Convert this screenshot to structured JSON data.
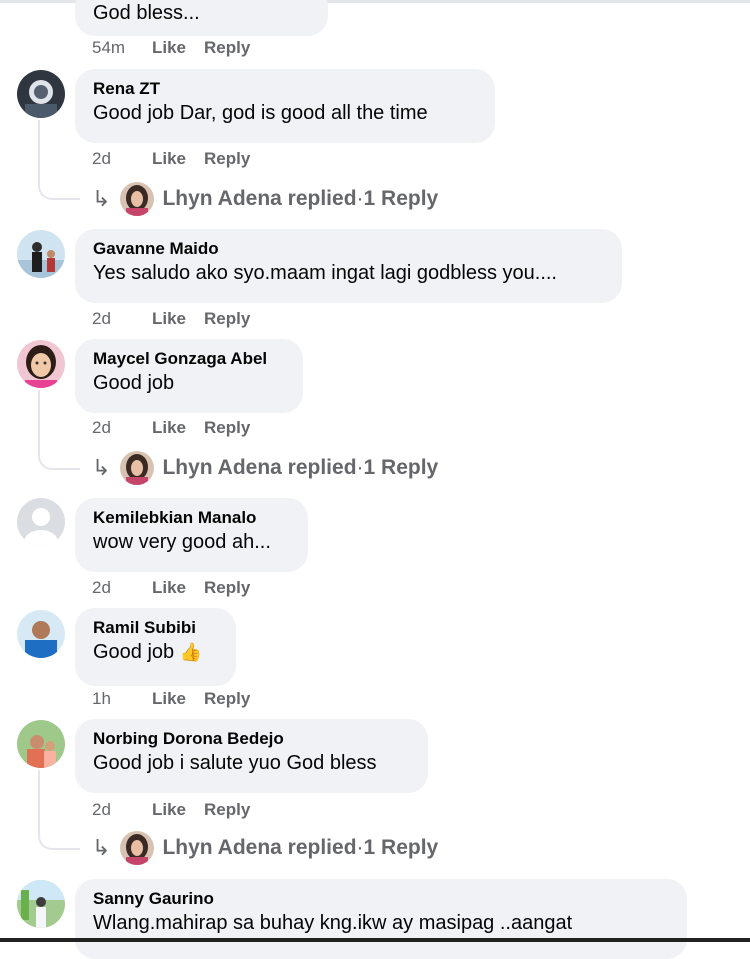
{
  "comments": [
    {
      "name": "",
      "text": "God bless...",
      "time": "54m",
      "like": "Like",
      "reply": "Reply"
    },
    {
      "name": "Rena ZT",
      "text": "Good job Dar, god is good all the time",
      "time": "2d",
      "like": "Like",
      "reply": "Reply",
      "replies_summary": {
        "replier": "Lhyn Adena replied",
        "count": "1 Reply",
        "sep": " · "
      }
    },
    {
      "name": "Gavanne Maido",
      "text": "Yes saludo ako syo.maam ingat lagi godbless you....",
      "time": "2d",
      "like": "Like",
      "reply": "Reply"
    },
    {
      "name": "Maycel Gonzaga Abel",
      "text": "Good job",
      "time": "2d",
      "like": "Like",
      "reply": "Reply",
      "replies_summary": {
        "replier": "Lhyn Adena replied",
        "count": "1 Reply",
        "sep": " · "
      }
    },
    {
      "name": "Kemilebkian Manalo",
      "text": "wow very good ah...",
      "time": "2d",
      "like": "Like",
      "reply": "Reply"
    },
    {
      "name": "Ramil Subibi",
      "text": "Good job",
      "emoji": "👍",
      "time": "1h",
      "like": "Like",
      "reply": "Reply"
    },
    {
      "name": "Norbing Dorona Bedejo",
      "text": "Good job i salute yuo God bless",
      "time": "2d",
      "like": "Like",
      "reply": "Reply",
      "replies_summary": {
        "replier": "Lhyn Adena replied",
        "count": "1 Reply",
        "sep": " · "
      }
    },
    {
      "name": "Sanny Gaurino",
      "text": "Wlang.mahirap sa buhay kng.ikw ay masipag ..aangat"
    }
  ],
  "icons": {
    "reply_arrow": "↳",
    "thumbs_up": "👍"
  },
  "colors": {
    "bubble_bg": "#f0f2f5",
    "meta_text": "#65676b",
    "name_text": "#050505"
  }
}
